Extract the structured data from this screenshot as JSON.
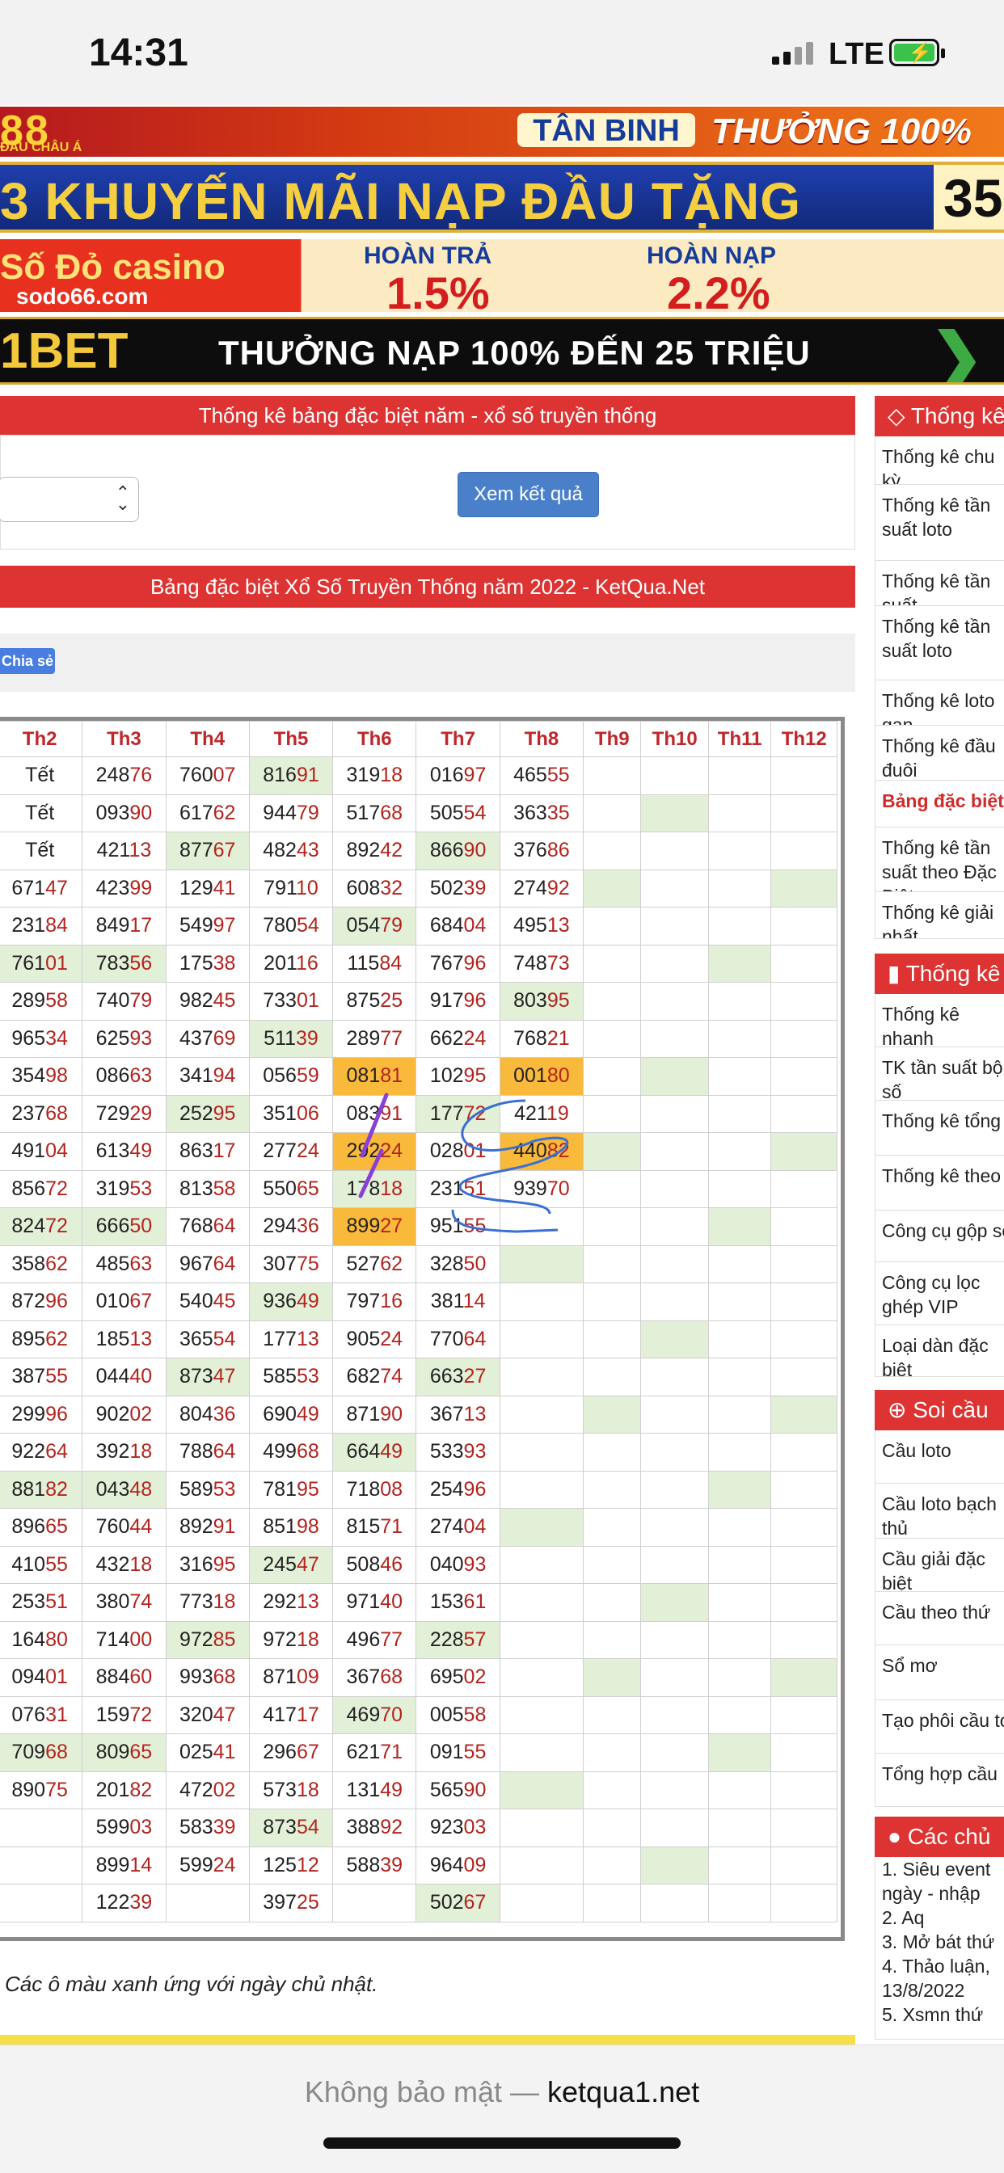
{
  "status": {
    "time": "14:31",
    "network": "LTE"
  },
  "banners": {
    "b1": {
      "logo": "88",
      "sub": "ĐẦU CHÂU Á",
      "pill": "TÂN BINH",
      "right": "THƯỞNG 100%"
    },
    "b2": {
      "text": "3 KHUYẾN MÃI NẠP ĐẦU TẶNG",
      "num": "35"
    },
    "b3": {
      "logo": "Số Đỏ casino",
      "site": "sodo66.com",
      "l1": "HOÀN TRẢ",
      "v1": "1.5%",
      "l2": "HOÀN NẠP",
      "v2": "2.2%"
    },
    "b4": {
      "logo": "1BET",
      "text": "THƯỞNG NẠP  100% ĐẾN 25 TRIỆU"
    }
  },
  "filter": {
    "title": "Thống kê bảng đặc biệt năm - xổ số truyền thống",
    "button": "Xem kết quả"
  },
  "table_title": "Bảng đặc biệt Xổ Số Truyền Thống năm 2022 - KetQua.Net",
  "share": "Chia sẻ",
  "columns": [
    "Th2",
    "Th3",
    "Th4",
    "Th5",
    "Th6",
    "Th7",
    "Th8",
    "Th9",
    "Th10",
    "Th11",
    "Th12"
  ],
  "rows": [
    [
      [
        "Tết",
        ""
      ],
      [
        "248",
        "76"
      ],
      [
        "760",
        "07"
      ],
      [
        "816",
        "91"
      ],
      [
        "319",
        "18"
      ],
      [
        "016",
        "97"
      ],
      [
        "465",
        "55"
      ],
      "",
      "",
      "",
      ""
    ],
    [
      [
        "Tết",
        ""
      ],
      [
        "093",
        "90"
      ],
      [
        "617",
        "62"
      ],
      [
        "944",
        "79"
      ],
      [
        "517",
        "68"
      ],
      [
        "505",
        "54"
      ],
      [
        "363",
        "35"
      ],
      "",
      "",
      "",
      ""
    ],
    [
      [
        "Tết",
        ""
      ],
      [
        "421",
        "13"
      ],
      [
        "877",
        "67"
      ],
      [
        "482",
        "43"
      ],
      [
        "892",
        "42"
      ],
      [
        "866",
        "90"
      ],
      [
        "376",
        "86"
      ],
      "",
      "",
      "",
      ""
    ],
    [
      [
        "671",
        "47"
      ],
      [
        "423",
        "99"
      ],
      [
        "129",
        "41"
      ],
      [
        "791",
        "10"
      ],
      [
        "608",
        "32"
      ],
      [
        "502",
        "39"
      ],
      [
        "274",
        "92"
      ],
      "",
      "",
      "",
      ""
    ],
    [
      [
        "231",
        "84"
      ],
      [
        "849",
        "17"
      ],
      [
        "549",
        "97"
      ],
      [
        "780",
        "54"
      ],
      [
        "054",
        "79"
      ],
      [
        "684",
        "04"
      ],
      [
        "495",
        "13"
      ],
      "",
      "",
      "",
      ""
    ],
    [
      [
        "761",
        "01"
      ],
      [
        "783",
        "56"
      ],
      [
        "175",
        "38"
      ],
      [
        "201",
        "16"
      ],
      [
        "115",
        "84"
      ],
      [
        "767",
        "96"
      ],
      [
        "748",
        "73"
      ],
      "",
      "",
      "",
      ""
    ],
    [
      [
        "289",
        "58"
      ],
      [
        "740",
        "79"
      ],
      [
        "982",
        "45"
      ],
      [
        "733",
        "01"
      ],
      [
        "875",
        "25"
      ],
      [
        "917",
        "96"
      ],
      [
        "803",
        "95"
      ],
      "",
      "",
      "",
      ""
    ],
    [
      [
        "965",
        "34"
      ],
      [
        "625",
        "93"
      ],
      [
        "437",
        "69"
      ],
      [
        "511",
        "39"
      ],
      [
        "289",
        "77"
      ],
      [
        "662",
        "24"
      ],
      [
        "768",
        "21"
      ],
      "",
      "",
      "",
      ""
    ],
    [
      [
        "354",
        "98"
      ],
      [
        "086",
        "63"
      ],
      [
        "341",
        "94"
      ],
      [
        "056",
        "59"
      ],
      [
        "081",
        "81"
      ],
      [
        "102",
        "95"
      ],
      [
        "001",
        "80"
      ],
      "",
      "",
      "",
      ""
    ],
    [
      [
        "237",
        "68"
      ],
      [
        "729",
        "29"
      ],
      [
        "252",
        "95"
      ],
      [
        "351",
        "06"
      ],
      [
        "083",
        "91"
      ],
      [
        "177",
        "72"
      ],
      [
        "421",
        "19"
      ],
      "",
      "",
      "",
      ""
    ],
    [
      [
        "491",
        "04"
      ],
      [
        "613",
        "49"
      ],
      [
        "863",
        "17"
      ],
      [
        "277",
        "24"
      ],
      [
        "292",
        "24"
      ],
      [
        "028",
        "01"
      ],
      [
        "440",
        "82"
      ],
      "",
      "",
      "",
      ""
    ],
    [
      [
        "856",
        "72"
      ],
      [
        "319",
        "53"
      ],
      [
        "813",
        "58"
      ],
      [
        "550",
        "65"
      ],
      [
        "178",
        "18"
      ],
      [
        "231",
        "51"
      ],
      [
        "939",
        "70"
      ],
      "",
      "",
      "",
      ""
    ],
    [
      [
        "824",
        "72"
      ],
      [
        "666",
        "50"
      ],
      [
        "768",
        "64"
      ],
      [
        "294",
        "36"
      ],
      [
        "899",
        "27"
      ],
      [
        "951",
        "55"
      ],
      "",
      "",
      "",
      "",
      ""
    ],
    [
      [
        "358",
        "62"
      ],
      [
        "485",
        "63"
      ],
      [
        "967",
        "64"
      ],
      [
        "307",
        "75"
      ],
      [
        "527",
        "62"
      ],
      [
        "328",
        "50"
      ],
      "",
      "",
      "",
      "",
      ""
    ],
    [
      [
        "872",
        "96"
      ],
      [
        "010",
        "67"
      ],
      [
        "540",
        "45"
      ],
      [
        "936",
        "49"
      ],
      [
        "797",
        "16"
      ],
      [
        "381",
        "14"
      ],
      "",
      "",
      "",
      "",
      ""
    ],
    [
      [
        "895",
        "62"
      ],
      [
        "185",
        "13"
      ],
      [
        "365",
        "54"
      ],
      [
        "177",
        "13"
      ],
      [
        "905",
        "24"
      ],
      [
        "770",
        "64"
      ],
      "",
      "",
      "",
      "",
      ""
    ],
    [
      [
        "387",
        "55"
      ],
      [
        "044",
        "40"
      ],
      [
        "873",
        "47"
      ],
      [
        "585",
        "53"
      ],
      [
        "682",
        "74"
      ],
      [
        "663",
        "27"
      ],
      "",
      "",
      "",
      "",
      ""
    ],
    [
      [
        "299",
        "96"
      ],
      [
        "902",
        "02"
      ],
      [
        "804",
        "36"
      ],
      [
        "690",
        "49"
      ],
      [
        "871",
        "90"
      ],
      [
        "367",
        "13"
      ],
      "",
      "",
      "",
      "",
      ""
    ],
    [
      [
        "922",
        "64"
      ],
      [
        "392",
        "18"
      ],
      [
        "788",
        "64"
      ],
      [
        "499",
        "68"
      ],
      [
        "664",
        "49"
      ],
      [
        "533",
        "93"
      ],
      "",
      "",
      "",
      "",
      ""
    ],
    [
      [
        "881",
        "82"
      ],
      [
        "043",
        "48"
      ],
      [
        "589",
        "53"
      ],
      [
        "781",
        "95"
      ],
      [
        "718",
        "08"
      ],
      [
        "254",
        "96"
      ],
      "",
      "",
      "",
      "",
      ""
    ],
    [
      [
        "896",
        "65"
      ],
      [
        "760",
        "44"
      ],
      [
        "892",
        "91"
      ],
      [
        "851",
        "98"
      ],
      [
        "815",
        "71"
      ],
      [
        "274",
        "04"
      ],
      "",
      "",
      "",
      "",
      ""
    ],
    [
      [
        "410",
        "55"
      ],
      [
        "432",
        "18"
      ],
      [
        "316",
        "95"
      ],
      [
        "245",
        "47"
      ],
      [
        "508",
        "46"
      ],
      [
        "040",
        "93"
      ],
      "",
      "",
      "",
      "",
      ""
    ],
    [
      [
        "253",
        "51"
      ],
      [
        "380",
        "74"
      ],
      [
        "773",
        "18"
      ],
      [
        "292",
        "13"
      ],
      [
        "971",
        "40"
      ],
      [
        "153",
        "61"
      ],
      "",
      "",
      "",
      "",
      ""
    ],
    [
      [
        "164",
        "80"
      ],
      [
        "714",
        "00"
      ],
      [
        "972",
        "85"
      ],
      [
        "972",
        "18"
      ],
      [
        "496",
        "77"
      ],
      [
        "228",
        "57"
      ],
      "",
      "",
      "",
      "",
      ""
    ],
    [
      [
        "094",
        "01"
      ],
      [
        "884",
        "60"
      ],
      [
        "993",
        "68"
      ],
      [
        "871",
        "09"
      ],
      [
        "367",
        "68"
      ],
      [
        "695",
        "02"
      ],
      "",
      "",
      "",
      "",
      ""
    ],
    [
      [
        "076",
        "31"
      ],
      [
        "159",
        "72"
      ],
      [
        "320",
        "47"
      ],
      [
        "417",
        "17"
      ],
      [
        "469",
        "70"
      ],
      [
        "005",
        "58"
      ],
      "",
      "",
      "",
      "",
      ""
    ],
    [
      [
        "709",
        "68"
      ],
      [
        "809",
        "65"
      ],
      [
        "025",
        "41"
      ],
      [
        "296",
        "67"
      ],
      [
        "621",
        "71"
      ],
      [
        "091",
        "55"
      ],
      "",
      "",
      "",
      "",
      ""
    ],
    [
      [
        "890",
        "75"
      ],
      [
        "201",
        "82"
      ],
      [
        "472",
        "02"
      ],
      [
        "573",
        "18"
      ],
      [
        "131",
        "49"
      ],
      [
        "565",
        "90"
      ],
      "",
      "",
      "",
      "",
      ""
    ],
    [
      "",
      [
        "599",
        "03"
      ],
      [
        "583",
        "39"
      ],
      [
        "873",
        "54"
      ],
      [
        "388",
        "92"
      ],
      [
        "923",
        "03"
      ],
      "",
      "",
      "",
      "",
      ""
    ],
    [
      "",
      [
        "899",
        "14"
      ],
      [
        "599",
        "24"
      ],
      [
        "125",
        "12"
      ],
      [
        "588",
        "39"
      ],
      [
        "964",
        "09"
      ],
      "",
      "",
      "",
      "",
      ""
    ],
    [
      "",
      [
        "122",
        "39"
      ],
      "",
      [
        "397",
        "25"
      ],
      "",
      [
        "502",
        "67"
      ],
      "",
      "",
      "",
      "",
      ""
    ]
  ],
  "highlights": {
    "green": [
      [
        0,
        3
      ],
      [
        1,
        8
      ],
      [
        2,
        2
      ],
      [
        2,
        5
      ],
      [
        3,
        7
      ],
      [
        3,
        10
      ],
      [
        4,
        4
      ],
      [
        5,
        0
      ],
      [
        5,
        1
      ],
      [
        5,
        9
      ],
      [
        6,
        6
      ],
      [
        7,
        3
      ],
      [
        8,
        8
      ],
      [
        9,
        2
      ],
      [
        9,
        5
      ],
      [
        10,
        7
      ],
      [
        10,
        10
      ],
      [
        11,
        4
      ],
      [
        12,
        0
      ],
      [
        12,
        1
      ],
      [
        12,
        9
      ],
      [
        13,
        6
      ],
      [
        14,
        3
      ],
      [
        15,
        8
      ],
      [
        16,
        2
      ],
      [
        16,
        5
      ],
      [
        17,
        7
      ],
      [
        17,
        10
      ],
      [
        18,
        4
      ],
      [
        19,
        0
      ],
      [
        19,
        1
      ],
      [
        19,
        9
      ],
      [
        20,
        6
      ],
      [
        21,
        3
      ],
      [
        22,
        8
      ],
      [
        23,
        2
      ],
      [
        23,
        5
      ],
      [
        24,
        7
      ],
      [
        24,
        10
      ],
      [
        25,
        4
      ],
      [
        26,
        0
      ],
      [
        26,
        1
      ],
      [
        26,
        9
      ],
      [
        27,
        6
      ],
      [
        28,
        3
      ],
      [
        29,
        8
      ],
      [
        30,
        5
      ]
    ],
    "orange": [
      [
        8,
        4
      ],
      [
        8,
        6
      ],
      [
        10,
        4
      ],
      [
        10,
        6
      ],
      [
        12,
        4
      ]
    ]
  },
  "note": "Các ô màu xanh ứng với ngày chủ nhật.",
  "sidebar": {
    "stats_title": "Thống kê",
    "stats_items": [
      "Thống kê chu kỳ",
      "Thống kê tần suất loto",
      "Thống kê tần suất",
      "Thống kê tần suất loto",
      "Thống kê loto gan",
      "Thống kê đầu đuôi",
      "Bảng đặc biệt",
      "Thống kê tần suất theo Đặc Biệt",
      "Thống kê giải nhất"
    ],
    "stats2_title": "Thống kê",
    "stats2_items": [
      "Thống kê nhanh",
      "TK tần suất bộ số",
      "Thống kê tổng",
      "Thống kê theo",
      "Công cụ gộp số",
      "Công cụ lọc ghép VIP",
      "Loại dàn đặc biệt"
    ],
    "soi_title": "Soi cầu",
    "soi_items": [
      "Cầu loto",
      "Cầu loto bạch thủ",
      "Cầu giải đặc biệt",
      "Cầu theo thứ",
      "Sổ mơ",
      "Tạo phôi cầu to",
      "Tổng hợp cầu"
    ],
    "topics_title": "Các chủ",
    "topics": [
      "1. Siêu event",
      "ngày - nhập",
      "2. Aq",
      "3. Mở bát thứ",
      "4. Thảo luận,",
      "13/8/2022",
      "5. Xsmn thứ"
    ]
  },
  "browser": {
    "security": "Không bảo mật — ",
    "domain": "ketqua1.net"
  }
}
